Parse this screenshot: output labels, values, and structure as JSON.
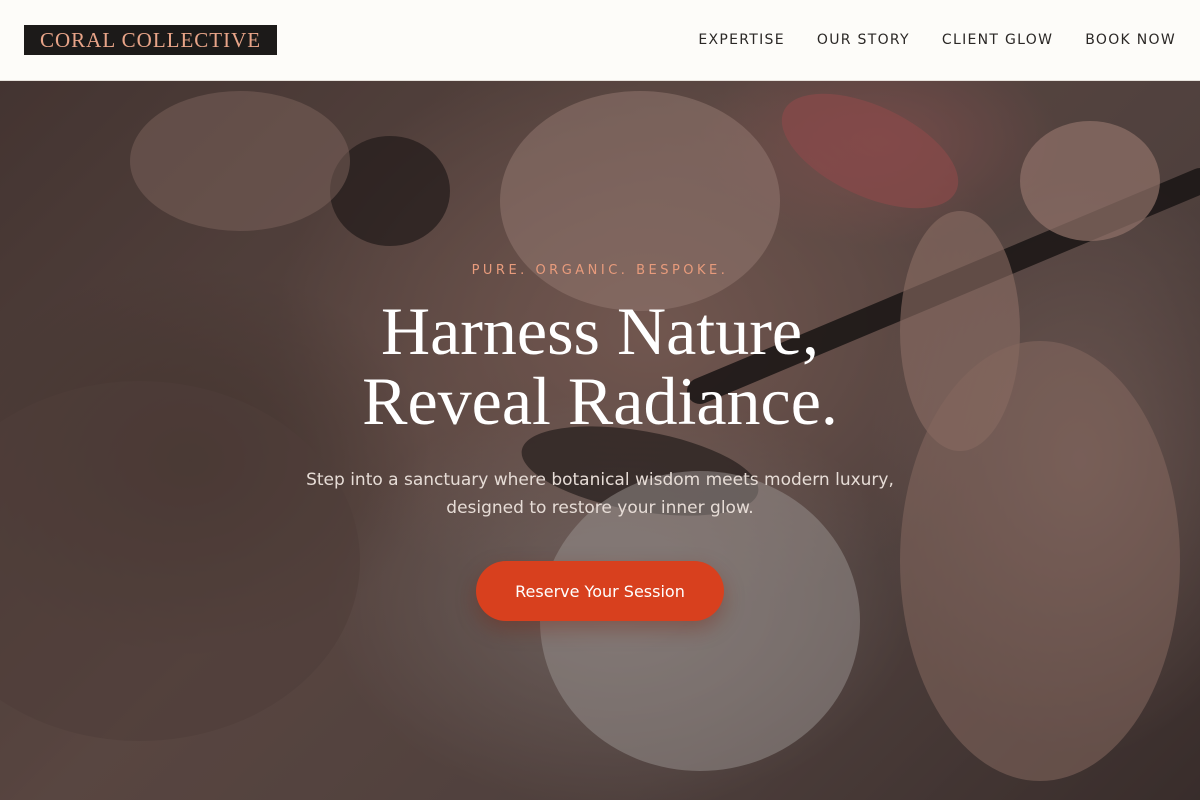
{
  "header": {
    "logo_text": "CORAL COLLECTIVE",
    "nav": [
      {
        "label": "EXPERTISE"
      },
      {
        "label": "OUR STORY"
      },
      {
        "label": "CLIENT GLOW"
      },
      {
        "label": "BOOK NOW"
      }
    ]
  },
  "hero": {
    "eyebrow": "PURE. ORGANIC. BESPOKE.",
    "headline_line1": "Harness Nature,",
    "headline_line2": "Reveal Radiance.",
    "subtext": "Step into a sanctuary where botanical wisdom meets modern luxury, designed to restore your inner glow.",
    "cta_label": "Reserve Your Session"
  },
  "colors": {
    "brand_accent": "#d8401e",
    "eyebrow": "#e89b7c",
    "logo_bg": "#1c1a19",
    "logo_text": "#e8a488"
  }
}
